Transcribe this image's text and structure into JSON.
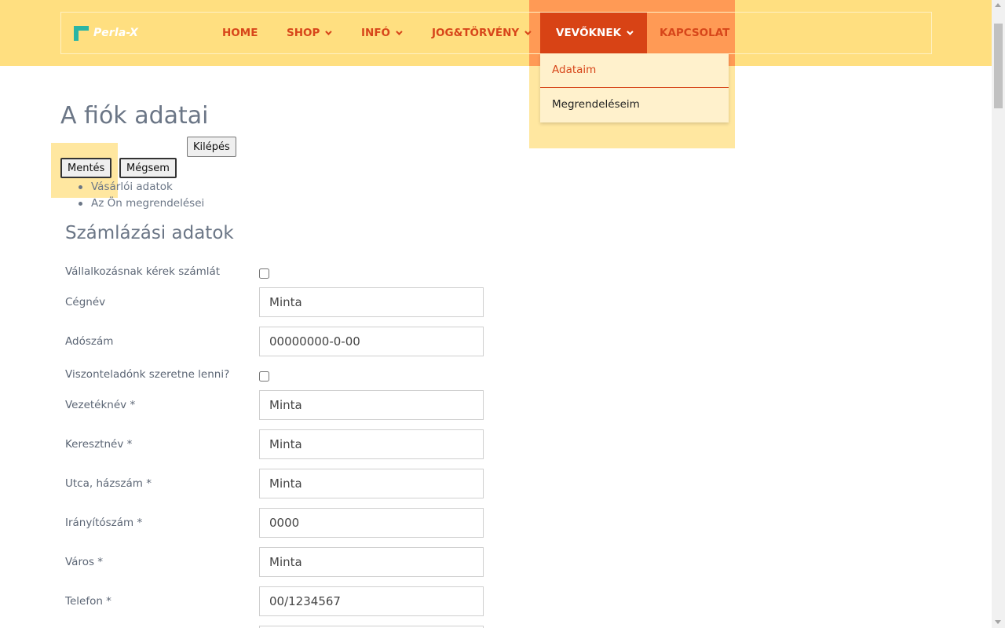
{
  "brand": {
    "name": "Perla-X",
    "accent": "#d84315",
    "header_bg": "#ffdf80"
  },
  "nav": {
    "items": [
      {
        "label": "HOME"
      },
      {
        "label": "SHOP"
      },
      {
        "label": "INFÓ"
      },
      {
        "label": "JOG&TÖRVÉNY"
      },
      {
        "label": "VEVŐKNEK"
      },
      {
        "label": "KAPCSOLAT"
      }
    ],
    "dropdown": [
      "Adataim",
      "Megrendeléseim"
    ]
  },
  "page": {
    "title": "A fiók adatai",
    "buttons": {
      "save": "Mentés",
      "cancel": "Mégsem",
      "logout": "Kilépés"
    },
    "tabs": [
      "Vásárlói adatok",
      "Az Ön megrendelései"
    ],
    "section_title": "Számlázási adatok"
  },
  "form": {
    "company_invoice": {
      "label": "Vállalkozásnak kérek számlát"
    },
    "company_name": {
      "label": "Cégnév",
      "value": "Minta"
    },
    "tax_number": {
      "label": "Adószám",
      "value": "00000000-0-00"
    },
    "reseller": {
      "label": "Viszonteladónk szeretne lenni?"
    },
    "last_name": {
      "label": "Vezetéknév *",
      "value": "Minta"
    },
    "first_name": {
      "label": "Keresztnév *",
      "value": "Minta"
    },
    "street": {
      "label": "Utca, házszám *",
      "value": "Minta"
    },
    "zip": {
      "label": "Irányítószám *",
      "value": "0000"
    },
    "city": {
      "label": "Város *",
      "value": "Minta"
    },
    "phone": {
      "label": "Telefon *",
      "value": "00/1234567"
    }
  }
}
